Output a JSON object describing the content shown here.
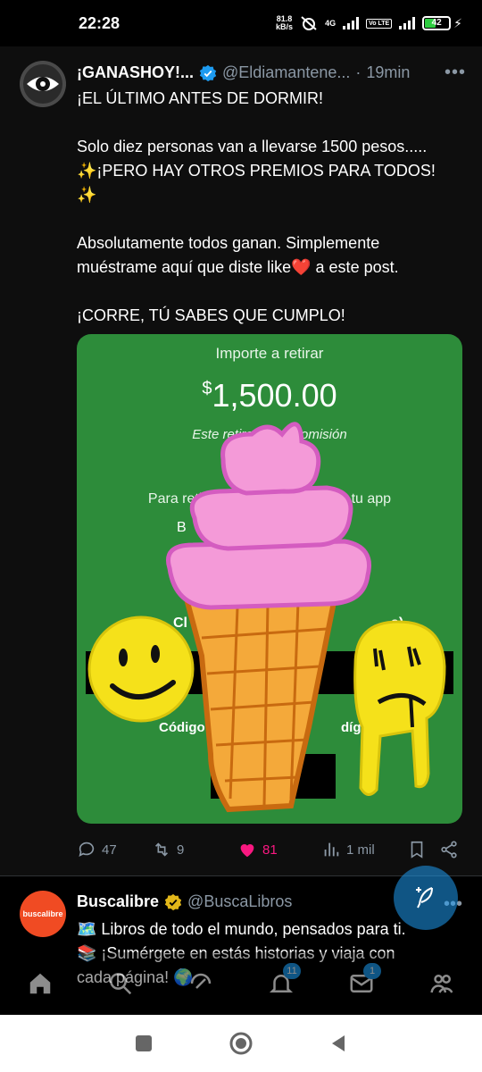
{
  "status_bar": {
    "time": "22:28",
    "net_speed_value": "81.8",
    "net_speed_unit": "kB/s",
    "network_type": "4G",
    "lte_label": "Vo LTE",
    "battery_percent": "42"
  },
  "tweet": {
    "author_name": "¡GANASHOY!...",
    "handle": "@Eldiamantene...",
    "time": "19min",
    "text_lines": [
      "¡EL ÚLTIMO ANTES DE DORMIR!",
      "",
      "Solo diez personas van a llevarse 1500 pesos.....",
      "✨¡PERO HAY OTROS PREMIOS PARA TODOS!",
      "✨",
      "",
      "Absolutamente todos ganan. Simplemente",
      "muéstrame aquí que diste like❤️ a este post.",
      "",
      "¡CORRE, TÚ SABES QUE CUMPLO!"
    ],
    "media": {
      "title": "Importe a retirar",
      "amount_symbol": "$",
      "amount": "1,500.00",
      "note": "Este retiro no ge    comisión",
      "instruction": "Para retirar el diner                l cajero con tu app",
      "fragment_b": "B",
      "fragment_ci": "Cl",
      "fragment_s": "s)",
      "fragment_codigo": "Código c",
      "fragment_digitos": "dígitos)",
      "background_color": "#2d8c3a"
    },
    "actions": {
      "replies": "47",
      "retweets": "9",
      "likes": "81",
      "views": "1 mil"
    },
    "like_color": "#f91880"
  },
  "tweet2": {
    "author_name": "Buscalibre",
    "handle": "@BuscaLibros",
    "avatar_text": "buscalibre",
    "text_lines": [
      "🗺️ Libros de todo el mundo, pensados para ti.",
      "📚 ¡Sumérgete en estás historias y viaja con",
      "cada página! 🌍"
    ]
  },
  "bottom_nav": {
    "items": [
      "home-icon",
      "search-icon",
      "spaces-icon",
      "notifications-icon",
      "messages-icon",
      "communities-icon"
    ],
    "notifications_badge": "11",
    "messages_badge": "1"
  },
  "accent_color": "#1d9bf0"
}
